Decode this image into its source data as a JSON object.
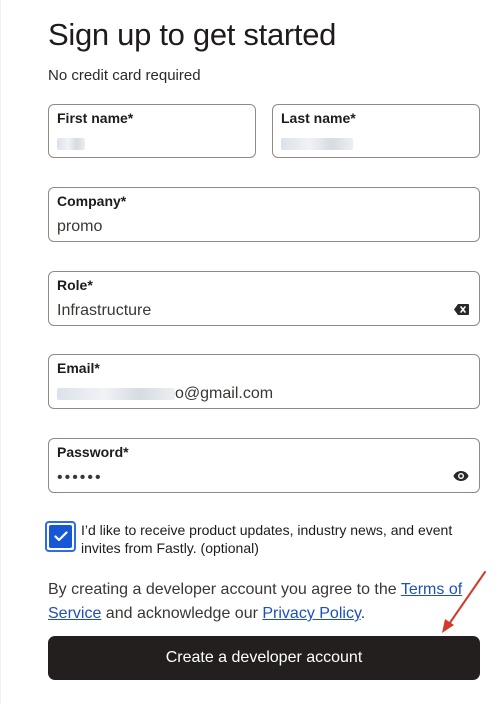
{
  "header": {
    "title": "Sign up to get started",
    "subtitle": "No credit card required"
  },
  "form": {
    "first_name": {
      "label": "First name*",
      "value": ""
    },
    "last_name": {
      "label": "Last name*",
      "value": ""
    },
    "company": {
      "label": "Company*",
      "value": "promo"
    },
    "role": {
      "label": "Role*",
      "value": "Infrastructure"
    },
    "email": {
      "label": "Email*",
      "value_visible": "o@gmail.com"
    },
    "password": {
      "label": "Password*",
      "value": "••••••"
    }
  },
  "consent": {
    "checked": true,
    "text": "I’d like to receive product updates, industry news, and event invites from Fastly. (optional)"
  },
  "legal": {
    "prefix": "By creating a developer account you agree to the ",
    "terms_link": "Terms of Service",
    "middle": " and acknowledge our ",
    "privacy_link": "Privacy Policy",
    "suffix": "."
  },
  "cta": {
    "label": "Create a developer account"
  },
  "colors": {
    "button_bg": "#231f1e",
    "checkbox_blue": "#1557d6",
    "link_blue": "#1d4fbf",
    "annotation_red": "#d33a2c"
  }
}
